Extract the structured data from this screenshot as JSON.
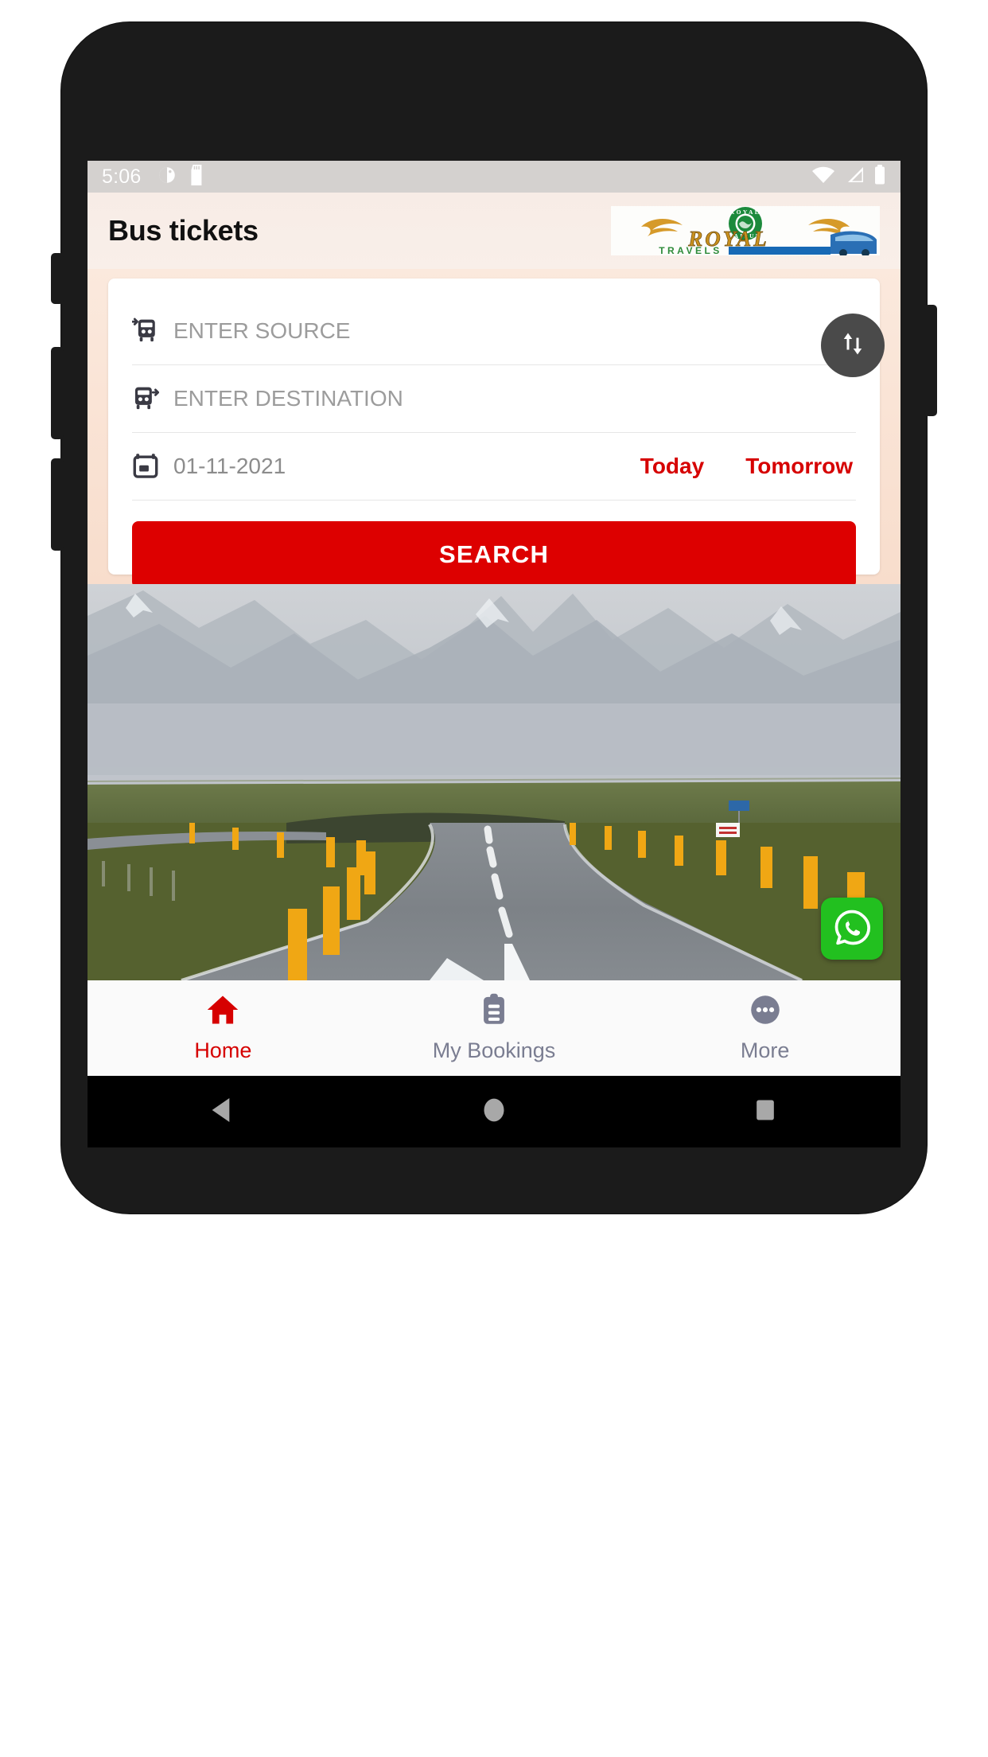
{
  "status_bar": {
    "time": "5:06",
    "left_icons": [
      "alarm-icon",
      "sd-card-icon"
    ],
    "right_icons": [
      "wifi-icon",
      "cell-signal-icon",
      "battery-icon"
    ]
  },
  "header": {
    "title": "Bus tickets",
    "logo": {
      "name": "royal-travels-logo",
      "emblem_top_text": "ROYAL",
      "emblem_bottom_text": "JAIPUR",
      "wordmark": "ROYAL",
      "subtitle": "TRAVELS"
    }
  },
  "search_form": {
    "source": {
      "placeholder": "ENTER SOURCE",
      "value": "",
      "icon": "bus-arrive-icon"
    },
    "destination": {
      "placeholder": "ENTER DESTINATION",
      "value": "",
      "icon": "bus-depart-icon"
    },
    "date": {
      "value": "01-11-2021",
      "icon": "calendar-icon"
    },
    "quick_dates": [
      {
        "label": "Today"
      },
      {
        "label": "Tomorrow"
      }
    ],
    "swap_button": {
      "icon": "swap-vertical-icon"
    },
    "search_button": {
      "label": "SEARCH"
    }
  },
  "hero": {
    "name": "scenic-road-photo",
    "description": "Empty asphalt highway curving through green fields toward misty snow-capped mountains, lined with yellow roadside posts"
  },
  "whatsapp_fab": {
    "icon": "whatsapp-icon"
  },
  "bottom_nav": {
    "items": [
      {
        "label": "Home",
        "icon": "home-icon",
        "active": true
      },
      {
        "label": "My Bookings",
        "icon": "clipboard-icon",
        "active": false
      },
      {
        "label": "More",
        "icon": "more-dots-icon",
        "active": false
      }
    ]
  },
  "android_nav": {
    "back": "back-triangle-icon",
    "home": "home-circle-icon",
    "recents": "recents-square-icon"
  },
  "colors": {
    "brand_red": "#dd0000",
    "accent_red": "#d60000",
    "header_bg": "#f7ece6",
    "card_bg": "#ffffff",
    "swap_button": "#4a4a4a",
    "whatsapp_green": "#22c01f",
    "nav_inactive": "#7a7d91",
    "status_bar_bg": "#d4d1cf"
  }
}
